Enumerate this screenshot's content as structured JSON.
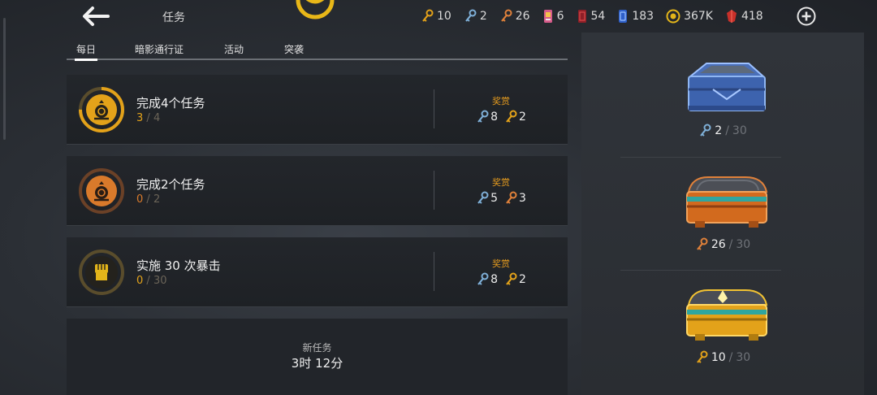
{
  "header": {
    "title": "任务",
    "resources": [
      {
        "icon": "gold-key-icon",
        "value": "10",
        "color": "#e3a21a"
      },
      {
        "icon": "blue-key-icon",
        "value": "2",
        "color": "#7fb0d8"
      },
      {
        "icon": "bronze-key-icon",
        "value": "26",
        "color": "#e0813a"
      },
      {
        "icon": "pink-ticket-icon",
        "value": "6",
        "color": "#d65c8a"
      },
      {
        "icon": "red-card-icon",
        "value": "54",
        "color": "#c0303a"
      },
      {
        "icon": "blue-card-icon",
        "value": "183",
        "color": "#3a6fd8"
      },
      {
        "icon": "gold-coin-icon",
        "value": "367K",
        "color": "#e3b51a"
      },
      {
        "icon": "red-gem-icon",
        "value": "418",
        "color": "#d03a2f"
      }
    ]
  },
  "tabs": [
    {
      "label": "每日",
      "active": true
    },
    {
      "label": "暗影通行证",
      "active": false
    },
    {
      "label": "活动",
      "active": false
    },
    {
      "label": "突袭",
      "active": false
    }
  ],
  "missions": [
    {
      "title": "完成4个任务",
      "current": "3",
      "sep": "/",
      "total": "4",
      "reward_label": "奖赏",
      "rewards": [
        {
          "icon": "blue-key-icon",
          "value": "8"
        },
        {
          "icon": "gold-key-icon",
          "value": "2"
        }
      ]
    },
    {
      "title": "完成2个任务",
      "current": "0",
      "sep": "/",
      "total": "2",
      "reward_label": "奖赏",
      "rewards": [
        {
          "icon": "blue-key-icon",
          "value": "5"
        },
        {
          "icon": "bronze-key-icon",
          "value": "3"
        }
      ]
    },
    {
      "title": "实施 30 次暴击",
      "current": "0",
      "sep": "/",
      "total": "30",
      "reward_label": "奖赏",
      "rewards": [
        {
          "icon": "blue-key-icon",
          "value": "8"
        },
        {
          "icon": "gold-key-icon",
          "value": "2"
        }
      ]
    }
  ],
  "new_task": {
    "label": "新任务",
    "time": "3时 12分"
  },
  "chests": [
    {
      "icon": "blue-chest-icon",
      "key_icon": "blue-key-icon",
      "current": "2",
      "sep": "/",
      "total": "30"
    },
    {
      "icon": "bronze-chest-icon",
      "key_icon": "bronze-key-icon",
      "current": "26",
      "sep": "/",
      "total": "30"
    },
    {
      "icon": "gold-chest-icon",
      "key_icon": "gold-key-icon",
      "current": "10",
      "sep": "/",
      "total": "30"
    }
  ],
  "mission_progress": [
    0.75,
    0,
    0
  ]
}
